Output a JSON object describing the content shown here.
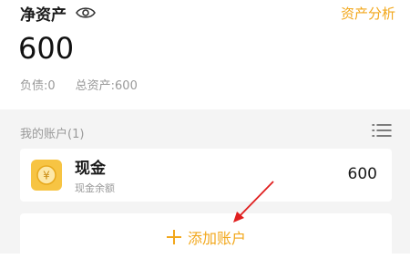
{
  "header": {
    "title": "净资产",
    "analysis_link": "资产分析",
    "net_value": "600",
    "liabilities": "负债:0",
    "total_assets": "总资产:600"
  },
  "accounts": {
    "heading": "我的账户(1)",
    "items": [
      {
        "name": "现金",
        "subtitle": "现金余额",
        "value": "600",
        "icon_symbol": "¥"
      }
    ],
    "add_label": "添加账户"
  },
  "colors": {
    "accent": "#f2a71b",
    "annotation_arrow": "#e02020"
  }
}
